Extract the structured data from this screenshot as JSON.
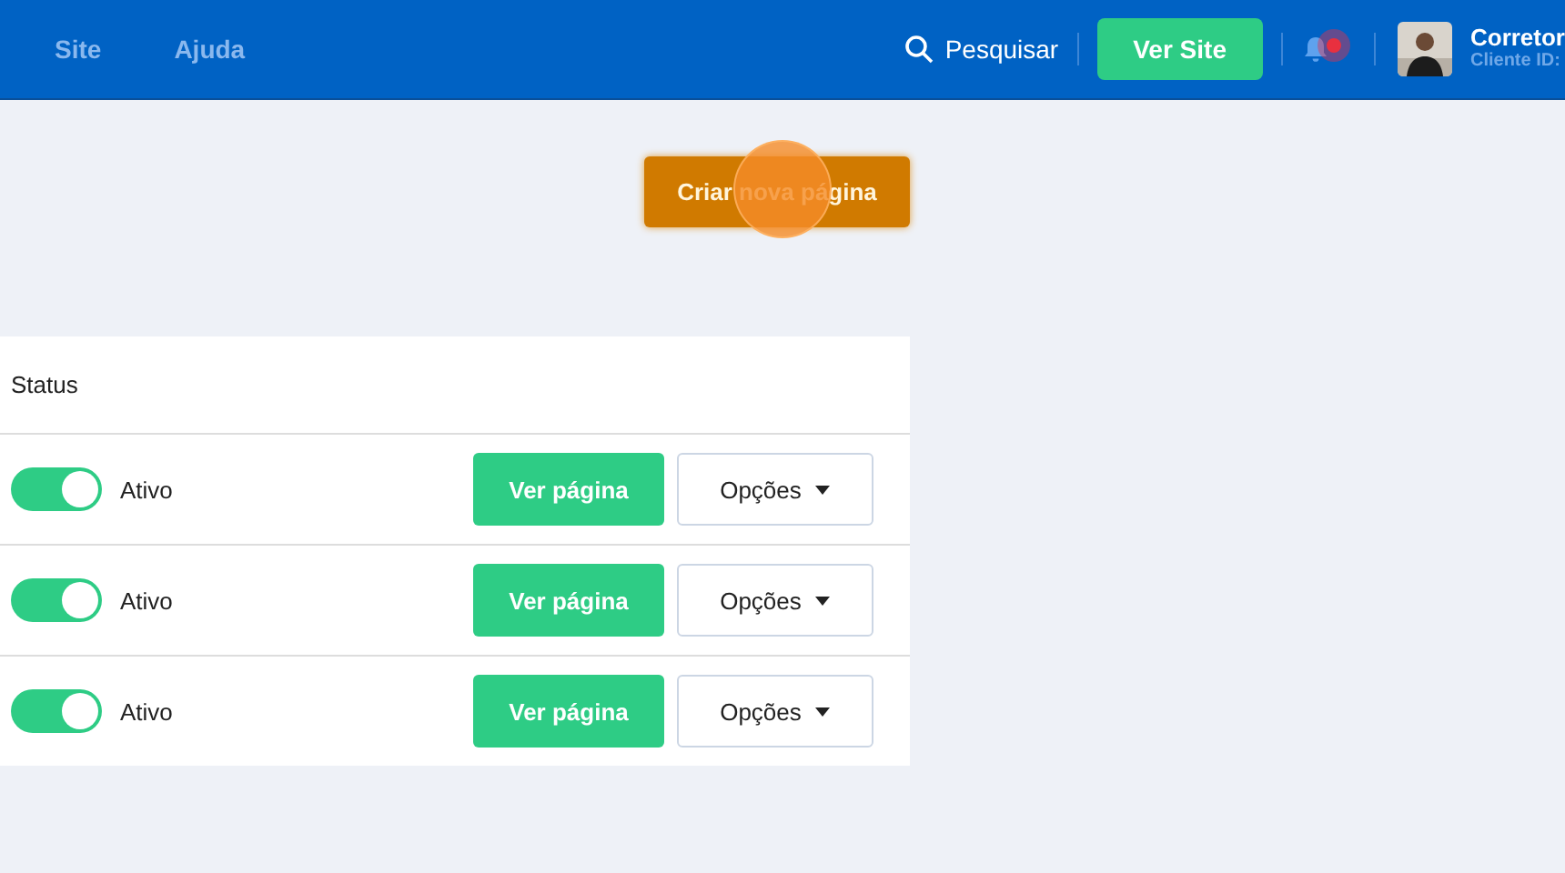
{
  "nav": {
    "links": [
      "Site",
      "Ajuda"
    ],
    "search": "Pesquisar",
    "view_site": "Ver Site",
    "notification": true,
    "user": {
      "name": "Corretor",
      "client": "Cliente ID:"
    }
  },
  "create_button": "Criar nova página",
  "table": {
    "columns": [
      "Status"
    ],
    "rows": [
      {
        "on": true,
        "status": "Ativo",
        "view": "Ver página",
        "options": "Opções"
      },
      {
        "on": true,
        "status": "Ativo",
        "view": "Ver página",
        "options": "Opções"
      },
      {
        "on": true,
        "status": "Ativo",
        "view": "Ver página",
        "options": "Opções"
      }
    ]
  }
}
